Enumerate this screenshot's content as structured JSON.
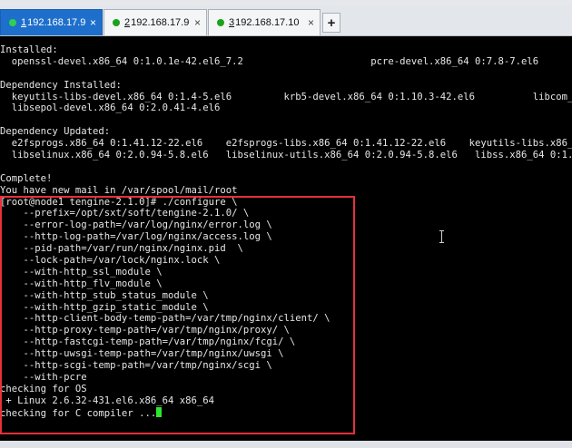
{
  "tabs": [
    {
      "number": "1",
      "label": "192.168.17.9",
      "active": true
    },
    {
      "number": "2",
      "label": "192.168.17.9",
      "active": false
    },
    {
      "number": "3",
      "label": "192.168.17.10",
      "active": false
    }
  ],
  "terminal": {
    "lines": [
      "Installed:",
      "  openssl-devel.x86_64 0:1.0.1e-42.el6_7.2                      pcre-devel.x86_64 0:7.8-7.el6",
      "",
      "Dependency Installed:",
      "  keyutils-libs-devel.x86_64 0:1.4-5.el6         krb5-devel.x86_64 0:1.10.3-42.el6          libcom_err-devel",
      "  libsepol-devel.x86_64 0:2.0.41-4.el6",
      "",
      "Dependency Updated:",
      "  e2fsprogs.x86_64 0:1.41.12-22.el6    e2fsprogs-libs.x86_64 0:1.41.12-22.el6    keyutils-libs.x86_64 0",
      "  libselinux.x86_64 0:2.0.94-5.8.el6   libselinux-utils.x86_64 0:2.0.94-5.8.el6   libss.x86_64 0:1.41.12-",
      "",
      "Complete!",
      "You have new mail in /var/spool/mail/root",
      "[root@node1 tengine-2.1.0]# ./configure \\",
      "    --prefix=/opt/sxt/soft/tengine-2.1.0/ \\",
      "    --error-log-path=/var/log/nginx/error.log \\",
      "    --http-log-path=/var/log/nginx/access.log \\",
      "    --pid-path=/var/run/nginx/nginx.pid  \\",
      "    --lock-path=/var/lock/nginx.lock \\",
      "    --with-http_ssl_module \\",
      "    --with-http_flv_module \\",
      "    --with-http_stub_status_module \\",
      "    --with-http_gzip_static_module \\",
      "    --http-client-body-temp-path=/var/tmp/nginx/client/ \\",
      "    --http-proxy-temp-path=/var/tmp/nginx/proxy/ \\",
      "    --http-fastcgi-temp-path=/var/tmp/nginx/fcgi/ \\",
      "    --http-uwsgi-temp-path=/var/tmp/nginx/uwsgi \\",
      "    --http-scgi-temp-path=/var/tmp/nginx/scgi \\",
      "    --with-pcre",
      "checking for OS",
      " + Linux 2.6.32-431.el6.x86_64 x86_64",
      "checking for C compiler ..."
    ]
  },
  "colors": {
    "terminal_bg": "#000000",
    "terminal_fg": "#e6e6e6",
    "cursor": "#2ee62e",
    "active_tab": "#1e6fcc",
    "status_dot": "#1aa31a",
    "highlight_border": "#e8303a"
  },
  "icons": {
    "tab_status": "green-dot-icon",
    "tab_close": "close-icon",
    "new_tab": "plus-icon",
    "mouse_cursor": "text-ibeam-cursor-icon"
  }
}
